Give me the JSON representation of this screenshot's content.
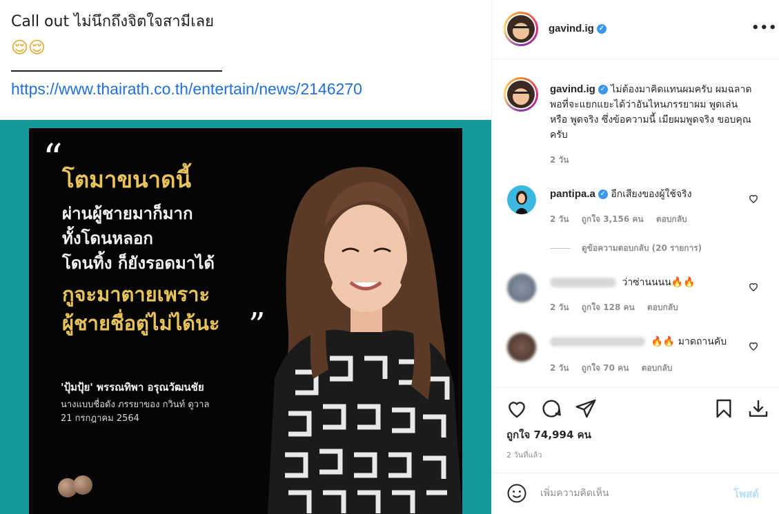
{
  "post_caption": {
    "line1": "Call out ไม่นึกถึงจิตใจสามีเลย",
    "emojis": "😌😌",
    "link": "https://www.thairath.co.th/entertain/news/2146270"
  },
  "poster": {
    "quote_open": "“",
    "line1": "โตมาขนาดนี้",
    "line2": "ผ่านผู้ชายมาก็มาก",
    "line3": "ทั้งโดนหลอก",
    "line4": "โดนทิ้ง ก็ยังรอดมาได้",
    "line5": "กูจะมาตายเพราะ",
    "line6": "ผู้ชายชื่อตู่ไม่ได้นะ",
    "quote_close": "”",
    "name": "'ปุ้มปุ้ย' พรรณทิพา อรุณวัฒนชัย",
    "sub1": "นางแบบชื่อดัง ภรรยาของ กวินท์ ดูวาล",
    "sub2": "21 กรกฎาคม 2564",
    "accent_color": "#e8c25a",
    "frame_color": "#149a9a"
  },
  "header": {
    "username": "gavind.ig",
    "verified_icon": "verified-badge-icon",
    "more_icon": "more-options-icon"
  },
  "comments": [
    {
      "username": "gavind.ig",
      "text": "ไม่ต้องมาคิดแทนผมครับ ผมฉลาดพอที่จะแยกแยะได้ว่าอันไหนภรรยาผม พูดเล่น หรือ พูดจริง ซึ่งข้อความนี้ เมียผมพูดจริง ขอบคุณครับ",
      "time": "2 วัน"
    },
    {
      "username": "pantipa.a",
      "text": "อีกเสียงของผู้ใช้จริง",
      "time": "2 วัน",
      "likes": "ถูกใจ 3,156 คน",
      "reply": "ตอบกลับ"
    },
    {
      "username": "",
      "text": "ว่าซ่านนนน🔥🔥",
      "time": "2 วัน",
      "likes": "ถูกใจ 128 คน",
      "reply": "ตอบกลับ"
    },
    {
      "username": "",
      "text": "🔥🔥 มาดถานคับ",
      "time": "2 วัน",
      "likes": "ถูกใจ 70 คน",
      "reply": "ตอบกลับ"
    }
  ],
  "view_replies": "ดูข้อความตอบกลับ (20 รายการ)",
  "actions": {
    "like_icon": "heart-icon",
    "comment_icon": "comment-icon",
    "share_icon": "share-icon",
    "save_icon": "bookmark-icon",
    "download_icon": "download-icon",
    "likes": "ถูกใจ 74,994 คน",
    "time_ago": "2 วันที่แล้ว"
  },
  "comment_box": {
    "placeholder": "เพิ่มความคิดเห็น",
    "post_label": "โพสต์",
    "emoji_icon": "smiley-icon"
  }
}
